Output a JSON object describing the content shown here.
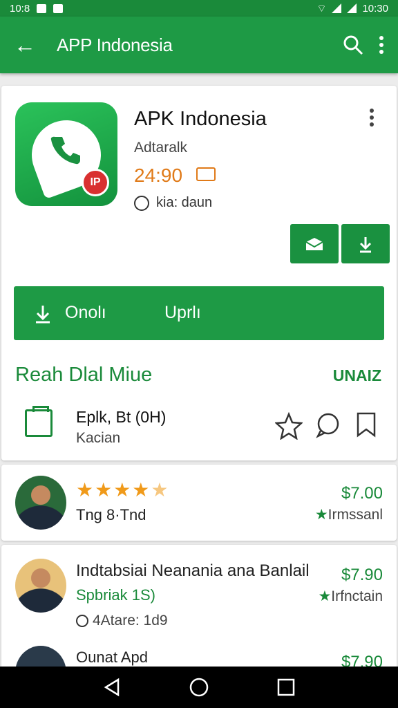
{
  "status_bar": {
    "time_left": "10:8",
    "time_right": "10:30"
  },
  "app_bar": {
    "title": "APP Indonesia"
  },
  "app": {
    "name": "APK Indonesia",
    "developer": "Adtaralk",
    "price": "24:90",
    "info": "kia: daun",
    "badge": "IP"
  },
  "install_button": {
    "label_left": "Onolı",
    "label_right": "Uprlı"
  },
  "section": {
    "title": "Reah Dlal Miue",
    "link": "UNAIZ"
  },
  "detail_row": {
    "title": "Eplk, Bt (0H)",
    "subtitle": "Kacian"
  },
  "reviews": [
    {
      "rating": 4.5,
      "name": "Tng 8·Tnd",
      "price": "$7.00",
      "meta": "Irmssanl"
    },
    {
      "name": "Indtabsiai Neanania ana Banlail",
      "price": "$7.90",
      "sub": "Spbriak 1S)",
      "meta": "Irfnctain",
      "extra": "4Atare: 1d9"
    },
    {
      "name": "Ounat Apd",
      "price": "$7.90"
    }
  ],
  "colors": {
    "primary": "#1e9a45",
    "accent": "#e07a18",
    "star": "#f09a1a"
  }
}
